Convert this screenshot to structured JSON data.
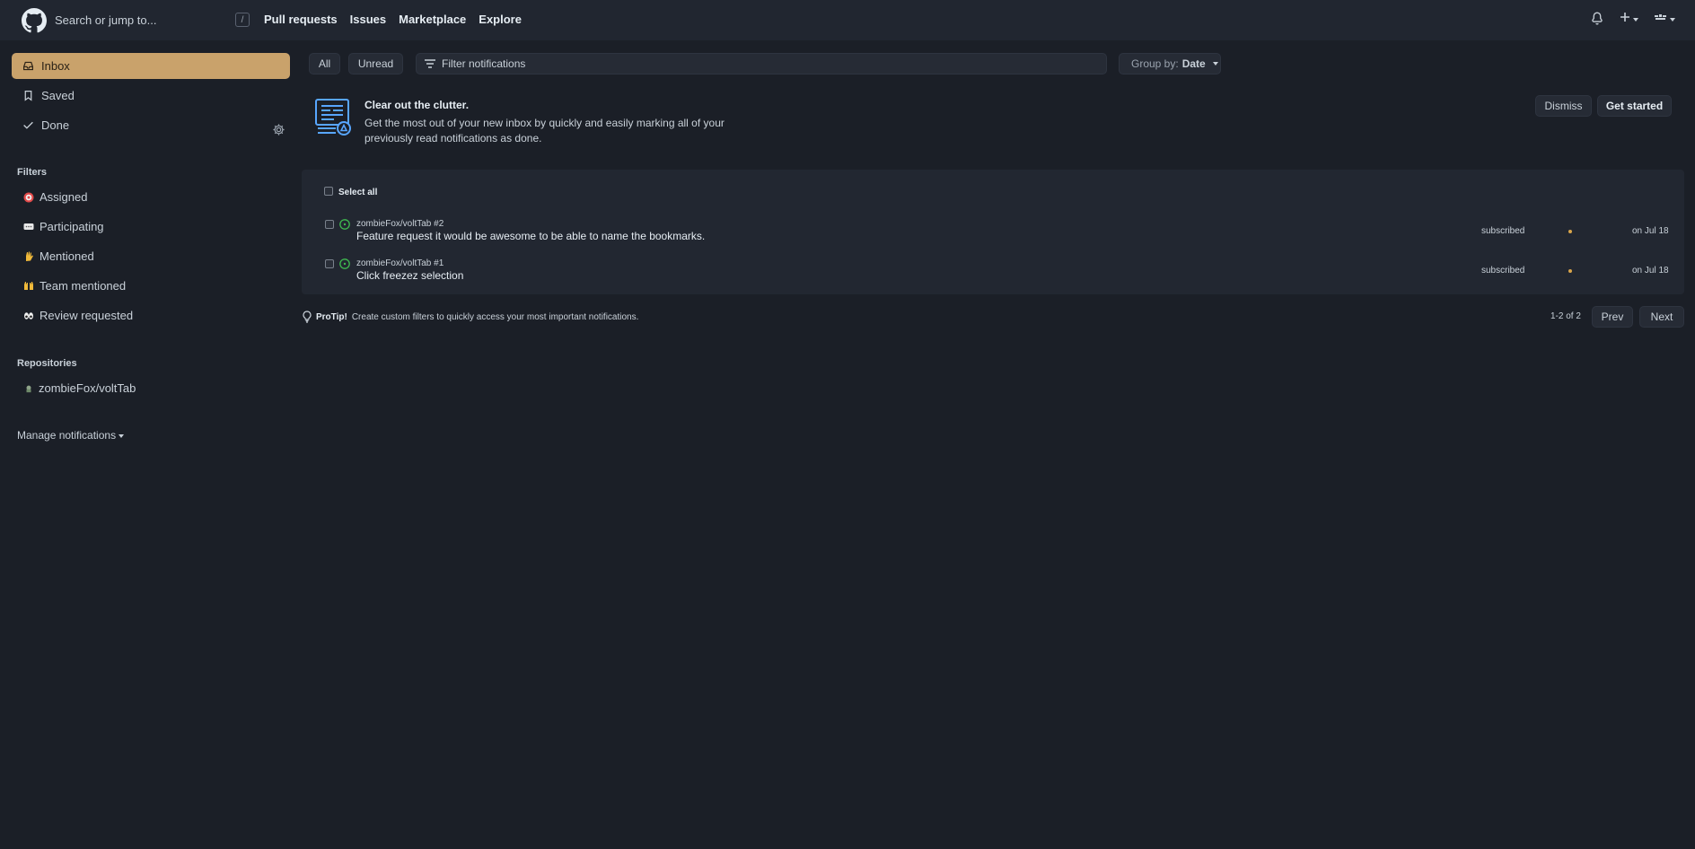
{
  "header": {
    "search_placeholder": "Search or jump to...",
    "slash_hint": "/",
    "nav": [
      "Pull requests",
      "Issues",
      "Marketplace",
      "Explore"
    ]
  },
  "sidebar": {
    "main_items": [
      {
        "label": "Inbox",
        "icon": "inbox-icon",
        "active": true
      },
      {
        "label": "Saved",
        "icon": "bookmark-icon"
      },
      {
        "label": "Done",
        "icon": "check-icon"
      }
    ],
    "filters_title": "Filters",
    "filters": [
      {
        "label": "Assigned",
        "icon": "dart-emoji-icon"
      },
      {
        "label": "Participating",
        "icon": "speech-bubble-emoji-icon"
      },
      {
        "label": "Mentioned",
        "icon": "raised-hand-emoji-icon"
      },
      {
        "label": "Team mentioned",
        "icon": "raised-hands-emoji-icon"
      },
      {
        "label": "Review requested",
        "icon": "eyes-emoji-icon"
      }
    ],
    "repositories_title": "Repositories",
    "repositories": [
      {
        "label": "zombieFox/voltTab",
        "icon": "repo-avatar-icon"
      }
    ],
    "manage_label": "Manage notifications"
  },
  "toolbar": {
    "all_label": "All",
    "unread_label": "Unread",
    "filter_placeholder": "Filter notifications",
    "groupby_prefix": "Group by:",
    "groupby_value": "Date"
  },
  "banner": {
    "title": "Clear out the clutter.",
    "text": "Get the most out of your new inbox by quickly and easily marking all of your previously read notifications as done.",
    "dismiss_label": "Dismiss",
    "get_started_label": "Get started"
  },
  "list": {
    "select_all_label": "Select all",
    "notifications": [
      {
        "repo": "zombieFox/voltTab #2",
        "title": "Feature request it would be awesome to be able to name the bookmarks.",
        "reason": "subscribed",
        "date": "on Jul 18"
      },
      {
        "repo": "zombieFox/voltTab #1",
        "title": "Click freezez selection",
        "reason": "subscribed",
        "date": "on Jul 18"
      }
    ]
  },
  "footer": {
    "protip_label": "ProTip!",
    "protip_text": "Create custom filters to quickly access your most important notifications.",
    "count": "1-2 of 2",
    "prev_label": "Prev",
    "next_label": "Next"
  },
  "colors": {
    "accent": "#c9a26b",
    "background": "#1b1f27",
    "header": "#212630",
    "open_issue": "#3fb950",
    "unread_dot": "#d9a54a"
  }
}
